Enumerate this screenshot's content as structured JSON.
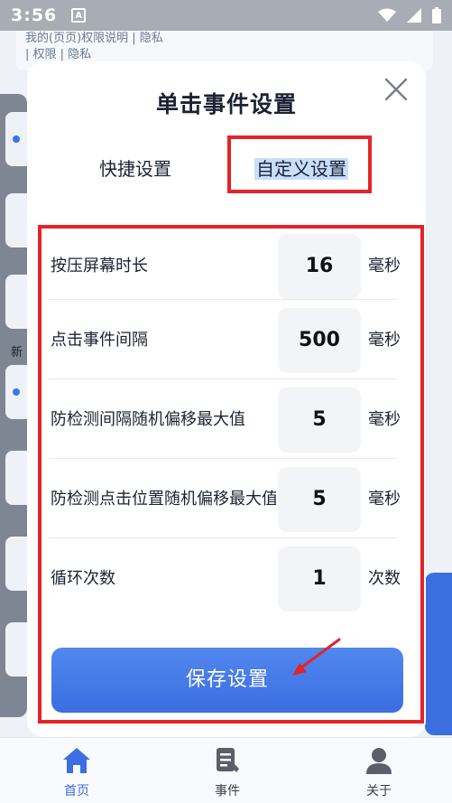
{
  "status_bar": {
    "time": "3:56",
    "notif_badge": "A"
  },
  "background": {
    "top_text_line1": "我的(页页)权限说明 | 隐私",
    "top_text_line2": "| 权限 | 隐私",
    "left_text": "新"
  },
  "dialog": {
    "title": "单击事件设置",
    "tabs": {
      "quick": "快捷设置",
      "custom": "自定义设置"
    },
    "rows": [
      {
        "label": "按压屏幕时长",
        "value": "16",
        "unit": "毫秒"
      },
      {
        "label": "点击事件间隔",
        "value": "500",
        "unit": "毫秒"
      },
      {
        "label": "防检测间隔随机偏移最大值",
        "value": "5",
        "unit": "毫秒"
      },
      {
        "label": "防检测点击位置随机偏移最大值",
        "value": "5",
        "unit": "毫秒"
      },
      {
        "label": "循环次数",
        "value": "1",
        "unit": "次数"
      }
    ],
    "save_label": "保存设置"
  },
  "bottom_nav": {
    "home": "首页",
    "events": "事件",
    "about": "关于"
  },
  "colors": {
    "accent": "#3a6ee2",
    "annotation_red": "#e4232a"
  }
}
